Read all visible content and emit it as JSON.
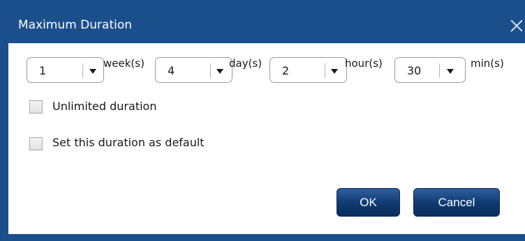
{
  "dialog": {
    "title": "Maximum Duration",
    "close_icon": "close-icon"
  },
  "duration": {
    "weeks": {
      "value": "1",
      "unit": "week(s)"
    },
    "days": {
      "value": "4",
      "unit": "day(s)"
    },
    "hours": {
      "value": "2",
      "unit": "hour(s)"
    },
    "minutes": {
      "value": "30",
      "unit": "min(s)"
    }
  },
  "options": {
    "unlimited": {
      "label": "Unlimited duration",
      "checked": false
    },
    "set_default": {
      "label": "Set this duration as default",
      "checked": false
    }
  },
  "buttons": {
    "ok": "OK",
    "cancel": "Cancel"
  },
  "colors": {
    "frame": "#1b4f8c",
    "button": "#0f386f"
  }
}
